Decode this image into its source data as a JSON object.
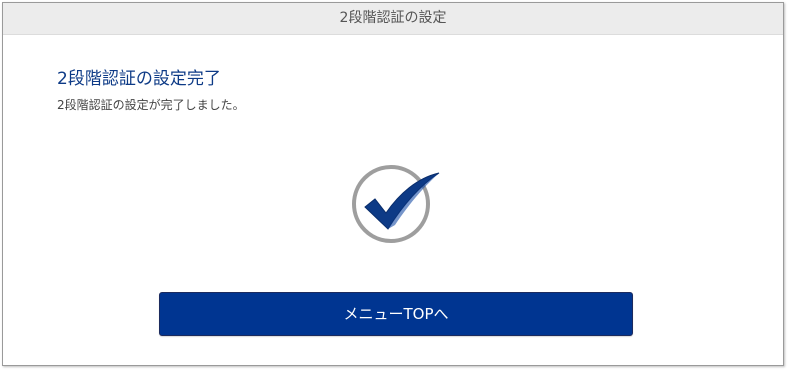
{
  "header": {
    "title": "2段階認証の設定"
  },
  "main": {
    "title": "2段階認証の設定完了",
    "message": "2段階認証の設定が完了しました。",
    "status_icon": "check-circle-icon",
    "menu_button_label": "メニューTOPへ"
  },
  "colors": {
    "accent": "#003591",
    "title": "#0d3a86",
    "header_bg": "#ececec",
    "check_ring": "#9e9e9e"
  }
}
